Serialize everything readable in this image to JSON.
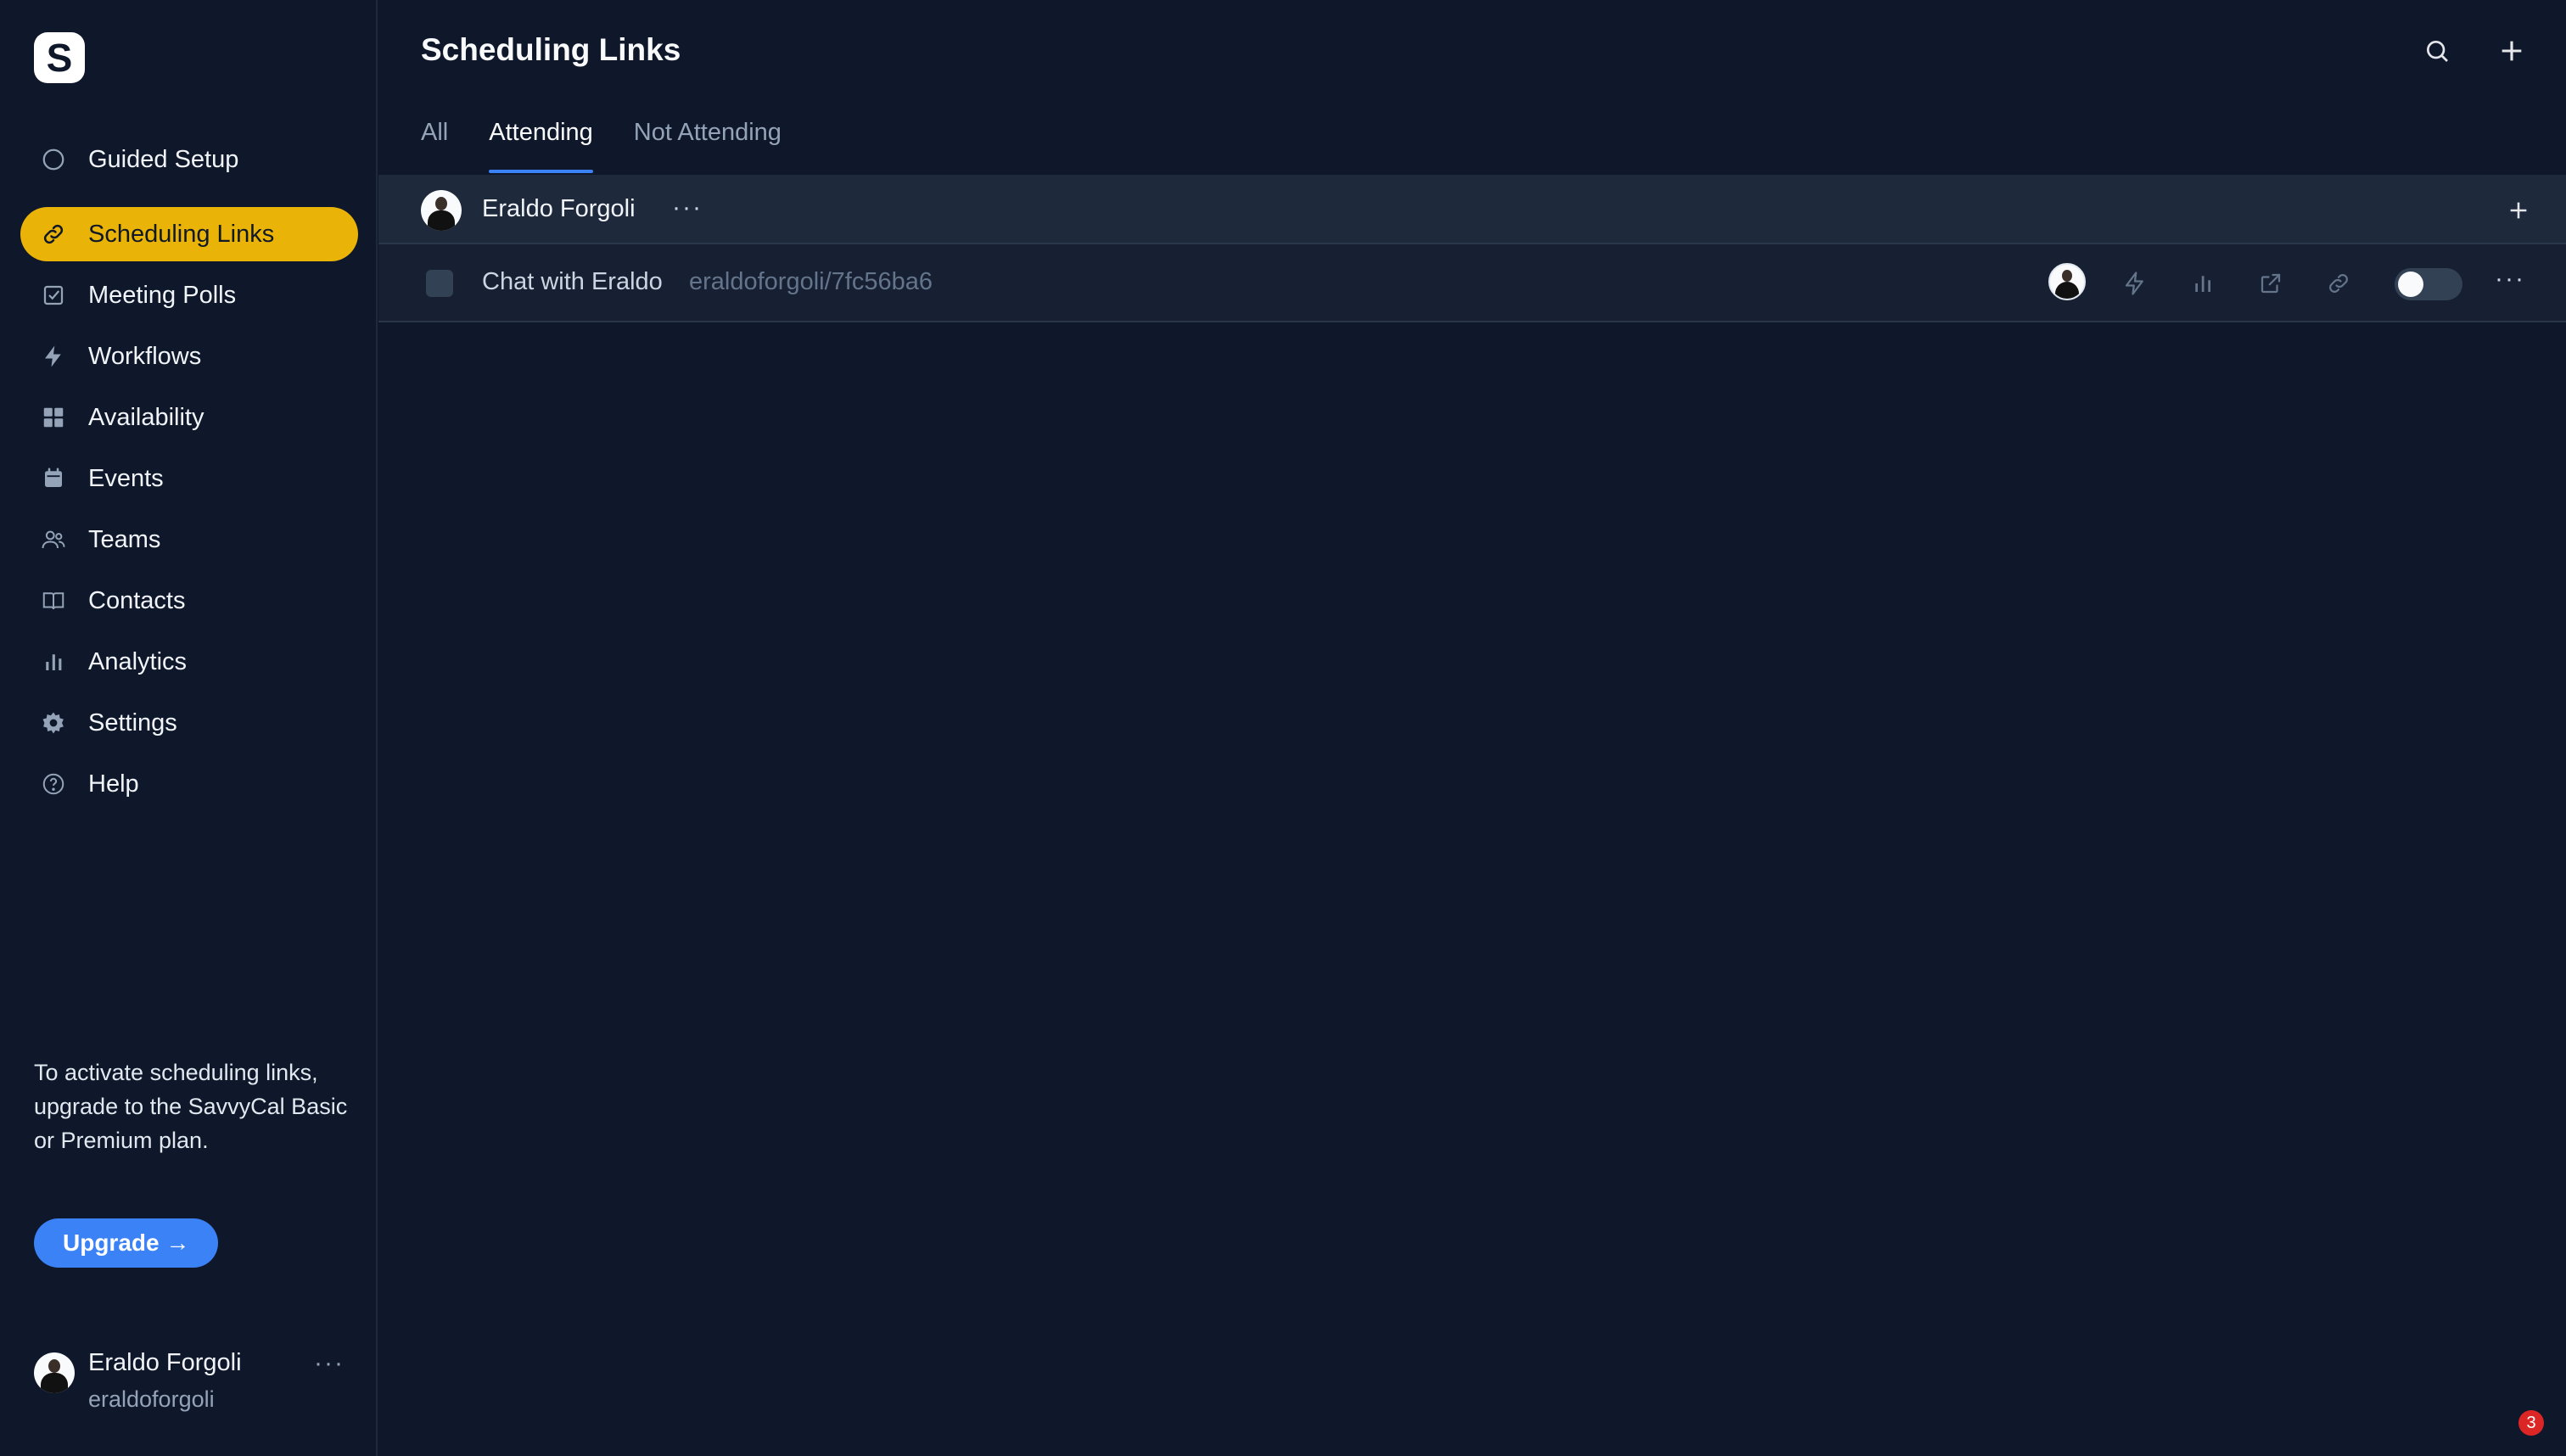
{
  "app": {
    "logo_letter": "S"
  },
  "sidebar": {
    "items": [
      {
        "label": "Guided Setup",
        "icon": "circle-icon",
        "active": false
      },
      {
        "label": "Scheduling Links",
        "icon": "link-icon",
        "active": true
      },
      {
        "label": "Meeting Polls",
        "icon": "checkbox-icon",
        "active": false
      },
      {
        "label": "Workflows",
        "icon": "bolt-icon",
        "active": false
      },
      {
        "label": "Availability",
        "icon": "grid-icon",
        "active": false
      },
      {
        "label": "Events",
        "icon": "calendar-icon",
        "active": false
      },
      {
        "label": "Teams",
        "icon": "users-icon",
        "active": false
      },
      {
        "label": "Contacts",
        "icon": "book-icon",
        "active": false
      },
      {
        "label": "Analytics",
        "icon": "bar-chart-icon",
        "active": false
      },
      {
        "label": "Settings",
        "icon": "gear-icon",
        "active": false
      },
      {
        "label": "Help",
        "icon": "help-icon",
        "active": false
      }
    ],
    "promo_text": "To activate scheduling links, upgrade to the SavvyCal Basic or Premium plan.",
    "upgrade_label": "Upgrade →",
    "profile": {
      "name": "Eraldo Forgoli",
      "handle": "eraldoforgoli",
      "more": "···"
    }
  },
  "header": {
    "title": "Scheduling Links"
  },
  "tabs": [
    {
      "label": "All",
      "active": false
    },
    {
      "label": "Attending",
      "active": true
    },
    {
      "label": "Not Attending",
      "active": false
    }
  ],
  "group": {
    "name": "Eraldo Forgoli",
    "more": "···"
  },
  "link": {
    "title": "Chat with Eraldo",
    "slug": "eraldoforgoli/7fc56ba6",
    "enabled": false,
    "more": "···"
  },
  "notification_count": "3",
  "colors": {
    "accent": "#eab308",
    "primary": "#3b82f6",
    "background": "#0f172a"
  }
}
